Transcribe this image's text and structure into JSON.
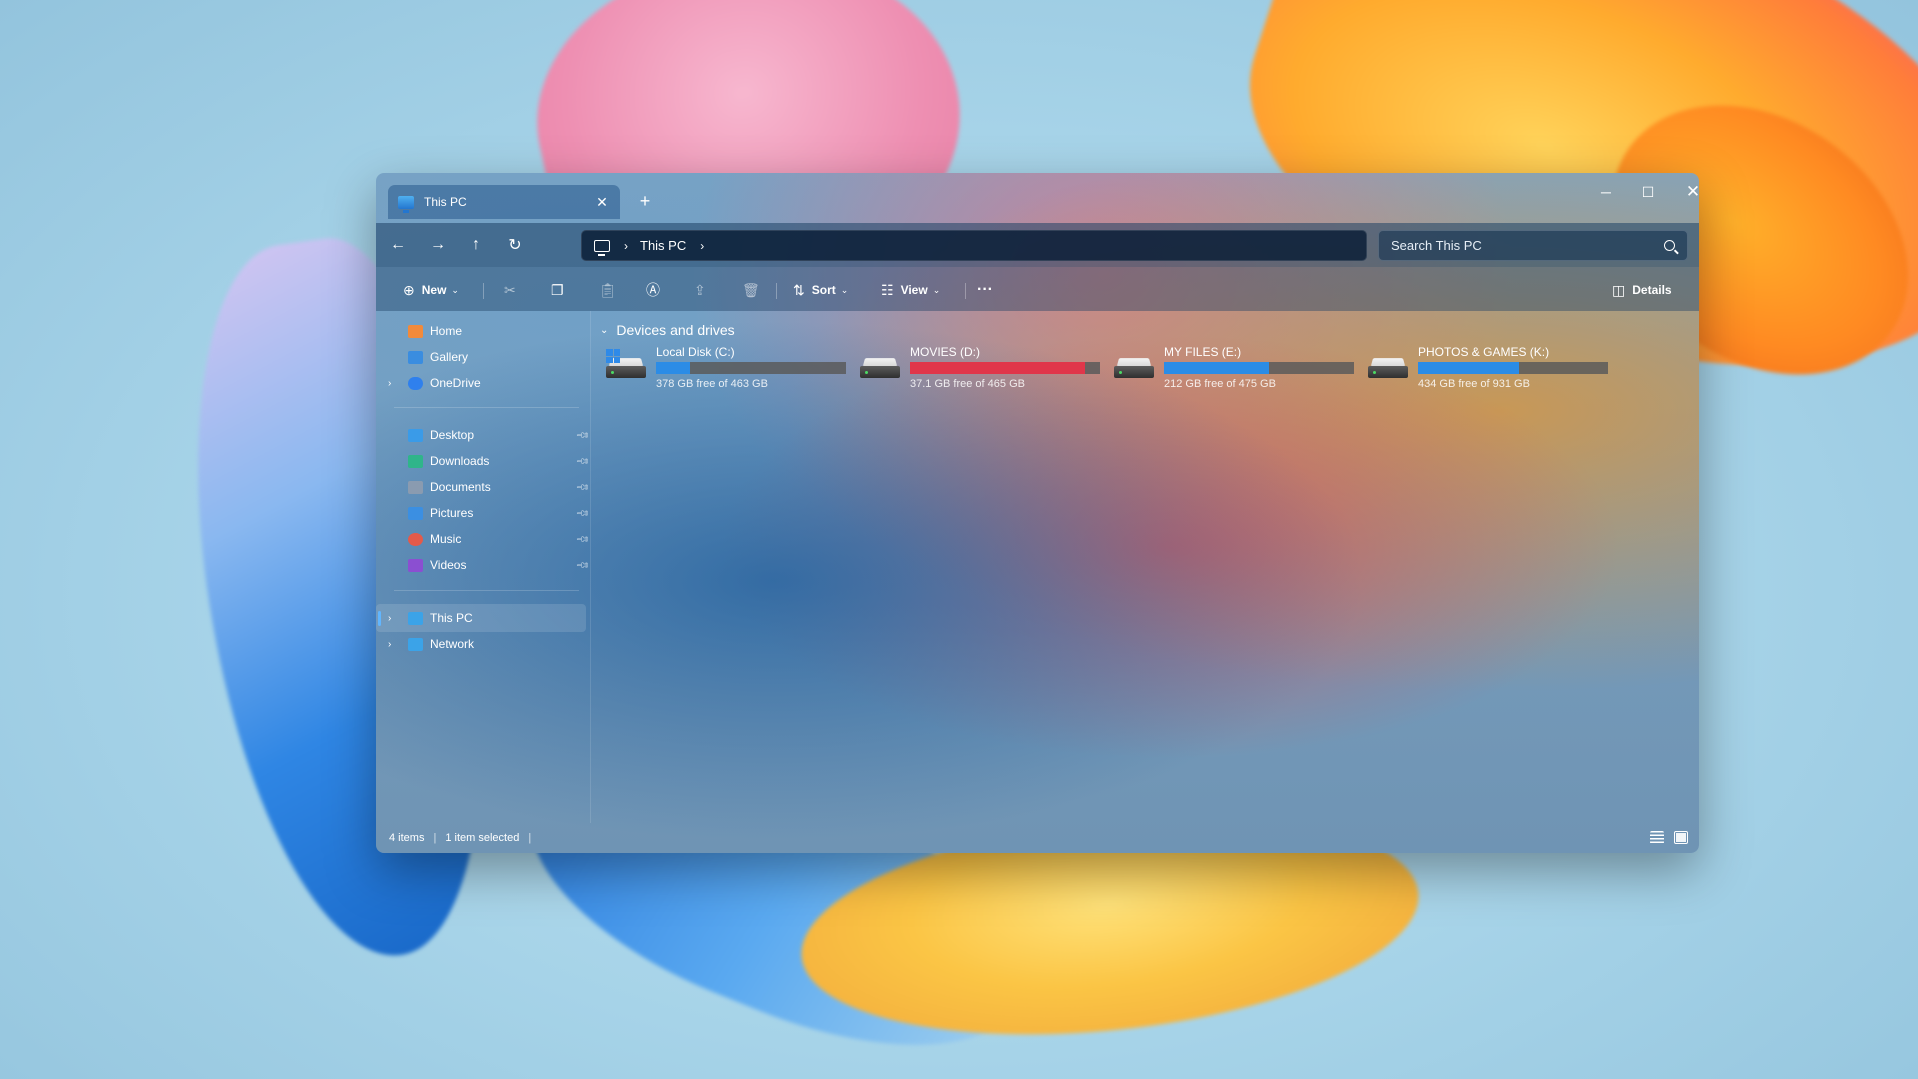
{
  "window": {
    "tab_title": "This PC",
    "new_tab_symbol": "+"
  },
  "address": {
    "crumbs": [
      "This PC"
    ]
  },
  "search": {
    "placeholder": "Search This PC"
  },
  "toolbar": {
    "new_label": "New",
    "sort_label": "Sort",
    "view_label": "View",
    "details_label": "Details",
    "more_symbol": "···"
  },
  "sidebar": {
    "top": [
      {
        "label": "Home",
        "icon": "home-icon",
        "color": "#f28a3a"
      },
      {
        "label": "Gallery",
        "icon": "gallery-icon",
        "color": "#3a8de0"
      },
      {
        "label": "OneDrive",
        "icon": "onedrive-icon",
        "color": "#2f80ed"
      }
    ],
    "quick": [
      {
        "label": "Desktop",
        "icon": "desktop-icon",
        "color": "#3a9be8"
      },
      {
        "label": "Downloads",
        "icon": "downloads-icon",
        "color": "#2fb58a"
      },
      {
        "label": "Documents",
        "icon": "documents-icon",
        "color": "#8a9bb0"
      },
      {
        "label": "Pictures",
        "icon": "pictures-icon",
        "color": "#3b8fe2"
      },
      {
        "label": "Music",
        "icon": "music-icon",
        "color": "#e45a4a"
      },
      {
        "label": "Videos",
        "icon": "videos-icon",
        "color": "#8b4fd1"
      }
    ],
    "bottom": [
      {
        "label": "This PC",
        "icon": "this-pc-icon",
        "color": "#3ba3e8"
      },
      {
        "label": "Network",
        "icon": "network-icon",
        "color": "#3ba3e8"
      }
    ]
  },
  "content": {
    "group_title": "Devices and drives",
    "drives": [
      {
        "name": "Local Disk (C:)",
        "free_text": "378 GB free of 463 GB",
        "used_fraction": 0.18,
        "bar_color": "#2b8ce6",
        "system": true
      },
      {
        "name": "MOVIES (D:)",
        "free_text": "37.1 GB free of 465 GB",
        "used_fraction": 0.92,
        "bar_color": "#e0364a",
        "system": false
      },
      {
        "name": "MY FILES (E:)",
        "free_text": "212 GB free of 475 GB",
        "used_fraction": 0.55,
        "bar_color": "#2b8ce6",
        "system": false
      },
      {
        "name": "PHOTOS & GAMES (K:)",
        "free_text": "434 GB free of 931 GB",
        "used_fraction": 0.53,
        "bar_color": "#2b8ce6",
        "system": false
      }
    ]
  },
  "status": {
    "items_count": "4 items",
    "selection": "1 item selected"
  }
}
